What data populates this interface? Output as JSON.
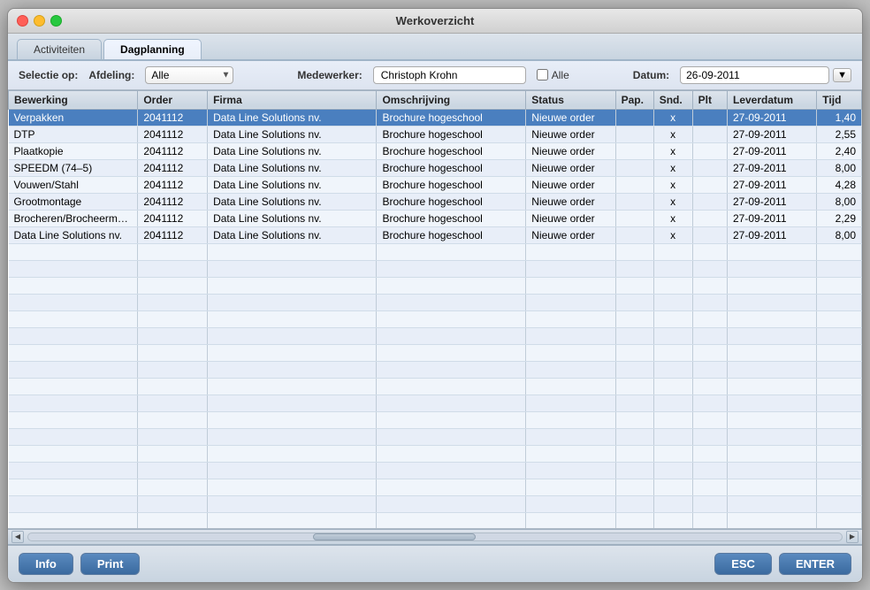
{
  "window": {
    "title": "Werkoverzicht"
  },
  "tabs": [
    {
      "id": "activiteiten",
      "label": "Activiteiten",
      "active": false
    },
    {
      "id": "dagplanning",
      "label": "Dagplanning",
      "active": true
    }
  ],
  "toolbar": {
    "selectie_label": "Selectie op:",
    "afdeling_label": "Afdeling:",
    "afdeling_value": "Alle",
    "afdeling_options": [
      "Alle"
    ],
    "medewerker_label": "Medewerker:",
    "medewerker_value": "Christoph Krohn",
    "alle_checkbox_label": "Alle",
    "datum_label": "Datum:",
    "datum_value": "26-09-2011"
  },
  "table": {
    "columns": [
      {
        "id": "bewerking",
        "label": "Bewerking"
      },
      {
        "id": "order",
        "label": "Order"
      },
      {
        "id": "firma",
        "label": "Firma"
      },
      {
        "id": "omschrijving",
        "label": "Omschrijving"
      },
      {
        "id": "status",
        "label": "Status"
      },
      {
        "id": "pap",
        "label": "Pap."
      },
      {
        "id": "snd",
        "label": "Snd."
      },
      {
        "id": "plt",
        "label": "Plt"
      },
      {
        "id": "leverdatum",
        "label": "Leverdatum"
      },
      {
        "id": "tijd",
        "label": "Tijd"
      }
    ],
    "rows": [
      {
        "bewerking": "Verpakken",
        "order": "2041112",
        "firma": "Data Line Solutions nv.",
        "omschrijving": "Brochure hogeschool",
        "status": "Nieuwe order",
        "pap": "",
        "snd": "x",
        "plt": "",
        "leverdatum": "27-09-2011",
        "tijd": "1,40",
        "selected": true
      },
      {
        "bewerking": "DTP",
        "order": "2041112",
        "firma": "Data Line Solutions nv.",
        "omschrijving": "Brochure hogeschool",
        "status": "Nieuwe order",
        "pap": "",
        "snd": "x",
        "plt": "",
        "leverdatum": "27-09-2011",
        "tijd": "2,55",
        "selected": false
      },
      {
        "bewerking": "Plaatkopie",
        "order": "2041112",
        "firma": "Data Line Solutions nv.",
        "omschrijving": "Brochure hogeschool",
        "status": "Nieuwe order",
        "pap": "",
        "snd": "x",
        "plt": "",
        "leverdatum": "27-09-2011",
        "tijd": "2,40",
        "selected": false
      },
      {
        "bewerking": "SPEEDM (74–5)",
        "order": "2041112",
        "firma": "Data Line Solutions nv.",
        "omschrijving": "Brochure hogeschool",
        "status": "Nieuwe order",
        "pap": "",
        "snd": "x",
        "plt": "",
        "leverdatum": "27-09-2011",
        "tijd": "8,00",
        "selected": false
      },
      {
        "bewerking": "Vouwen/Stahl",
        "order": "2041112",
        "firma": "Data Line Solutions nv.",
        "omschrijving": "Brochure hogeschool",
        "status": "Nieuwe order",
        "pap": "",
        "snd": "x",
        "plt": "",
        "leverdatum": "27-09-2011",
        "tijd": "4,28",
        "selected": false
      },
      {
        "bewerking": "Grootmontage",
        "order": "2041112",
        "firma": "Data Line Solutions nv.",
        "omschrijving": "Brochure hogeschool",
        "status": "Nieuwe order",
        "pap": "",
        "snd": "x",
        "plt": "",
        "leverdatum": "27-09-2011",
        "tijd": "8,00",
        "selected": false
      },
      {
        "bewerking": "Brocheren/Brocheermachi",
        "order": "2041112",
        "firma": "Data Line Solutions nv.",
        "omschrijving": "Brochure hogeschool",
        "status": "Nieuwe order",
        "pap": "",
        "snd": "x",
        "plt": "",
        "leverdatum": "27-09-2011",
        "tijd": "2,29",
        "selected": false
      },
      {
        "bewerking": "Data Line Solutions nv.",
        "order": "2041112",
        "firma": "Data Line Solutions nv.",
        "omschrijving": "Brochure hogeschool",
        "status": "Nieuwe order",
        "pap": "",
        "snd": "x",
        "plt": "",
        "leverdatum": "27-09-2011",
        "tijd": "8,00",
        "selected": false
      }
    ]
  },
  "bottom": {
    "info_label": "Info",
    "print_label": "Print",
    "esc_label": "ESC",
    "enter_label": "ENTER"
  }
}
